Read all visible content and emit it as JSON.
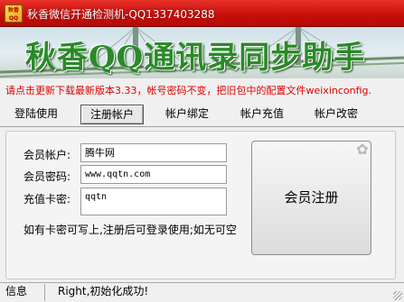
{
  "window": {
    "icon_text": "秋香QQ",
    "title": "秋香微信开通检测机-QQ1337403288"
  },
  "banner": {
    "text": "秋香QQ通讯录同步助手"
  },
  "notice": "请点击更新下载最新版本3.33，帐号密码不变，把旧包中的配置文件weixinconfig.",
  "tabs": [
    {
      "label": "登陆使用",
      "active": false
    },
    {
      "label": "注册帐户",
      "active": true
    },
    {
      "label": "帐户绑定",
      "active": false
    },
    {
      "label": "帐户充值",
      "active": false
    },
    {
      "label": "帐户改密",
      "active": false
    }
  ],
  "form": {
    "account_label": "会员帐户:",
    "account_value": "腾牛网",
    "password_label": "会员密码:",
    "password_value": "www.qqtn.com",
    "card_label": "充值卡密:",
    "card_value": "qqtn",
    "hint": "如有卡密可写上,注册后可登录使用;如无可空",
    "register_button": "会员注册"
  },
  "status": {
    "label": "信息",
    "message": "Right,初始化成功!"
  },
  "colors": {
    "titlebar": "#c80f0a",
    "notice": "#e00000",
    "banner_text": "#2a8a28"
  },
  "icons": {
    "app": "app-logo-icon",
    "gear": "gear-icon",
    "grip": "resize-grip-icon"
  }
}
